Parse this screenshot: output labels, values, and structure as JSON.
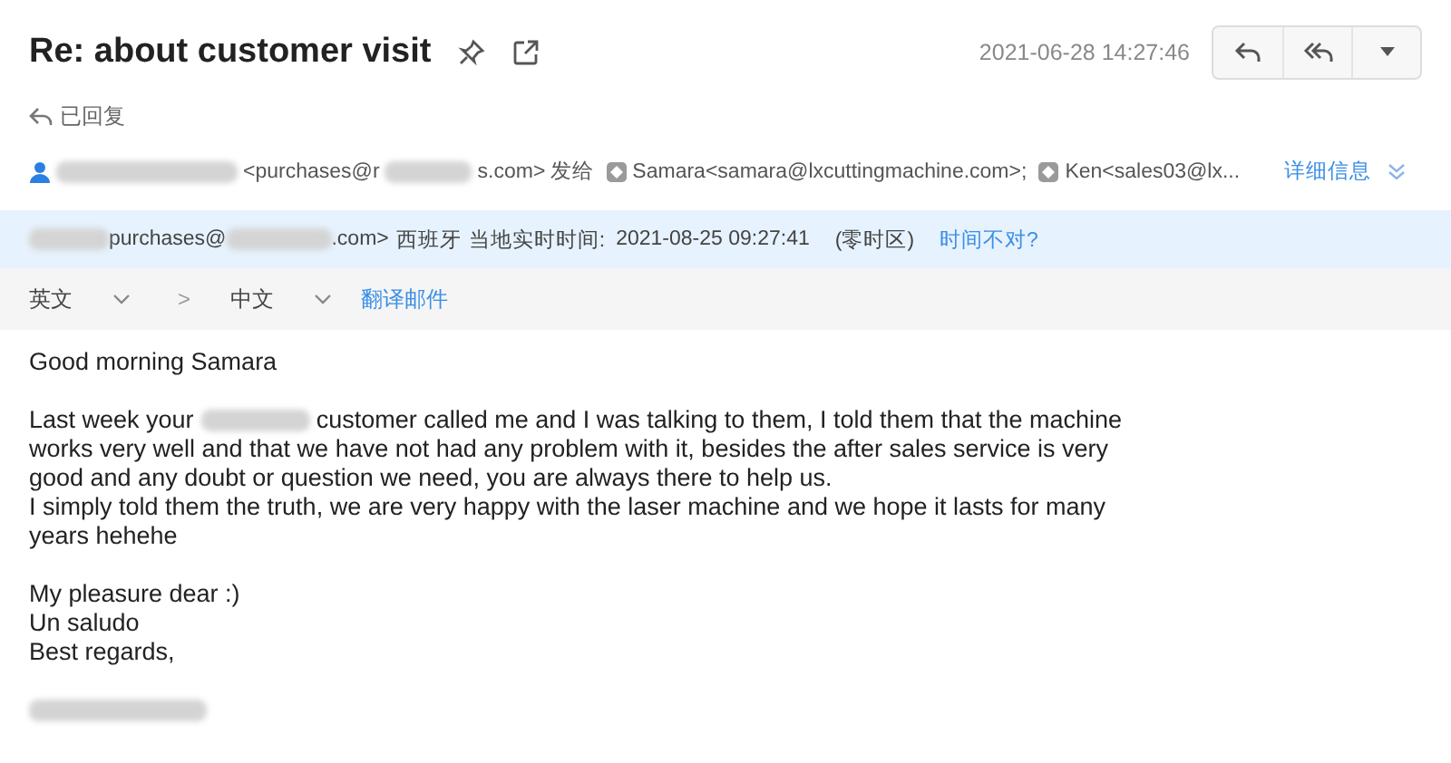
{
  "header": {
    "subject": "Re: about customer visit",
    "date": "2021-06-28 14:27:46",
    "status": "已回复"
  },
  "recipients": {
    "sender_parts": [
      "<purchases@r",
      "s.com>"
    ],
    "sent_to": "发给",
    "to": [
      {
        "name": "Samara",
        "address": "<samara@lxcuttingmachine.com>;"
      },
      {
        "name": "Ken",
        "address": "<sales03@lx..."
      }
    ],
    "details_link": "详细信息"
  },
  "timezone_banner": {
    "sender_parts": [
      "purchases@",
      ".com>"
    ],
    "country": "西班牙",
    "label": "当地实时时间:",
    "time": "2021-08-25 09:27:41",
    "zone": "(零时区)",
    "link": "时间不对?"
  },
  "translate_bar": {
    "from": "英文",
    "arrow": ">",
    "to": "中文",
    "action": "翻译邮件"
  },
  "body": {
    "greeting": "Good morning Samara",
    "first_line_before": "Last week your",
    "first_line_after": "customer called me and I was talking to them, I told them that the machine",
    "lines": [
      "works very well and that we have not had any problem with it, besides the after sales service is very",
      "good and any doubt or question we need, you are always there to help us.",
      "I simply told them the truth, we are very happy with the laser machine and we hope it lasts for many",
      "years hehehe"
    ],
    "closing": [
      "My pleasure dear :)",
      "Un saludo",
      "Best regards,"
    ]
  }
}
